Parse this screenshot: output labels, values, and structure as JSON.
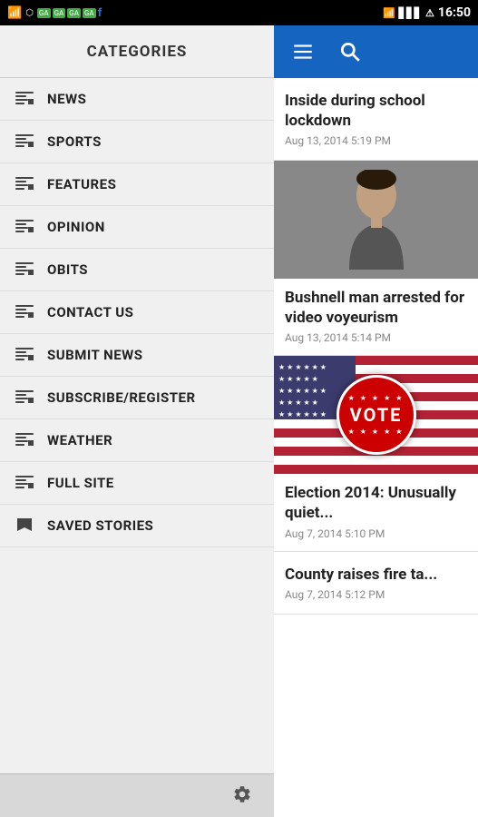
{
  "statusBar": {
    "time": "16:50",
    "icons_left": [
      "signal-icon",
      "wifi-icon",
      "battery-icon"
    ]
  },
  "sidebar": {
    "header": "CATEGORIES",
    "items": [
      {
        "id": "news",
        "label": "NEWS"
      },
      {
        "id": "sports",
        "label": "SPORTS"
      },
      {
        "id": "features",
        "label": "FEATURES"
      },
      {
        "id": "opinion",
        "label": "OPINION"
      },
      {
        "id": "obits",
        "label": "OBITS"
      },
      {
        "id": "contact",
        "label": "CONTACT US"
      },
      {
        "id": "submit",
        "label": "SUBMIT NEWS"
      },
      {
        "id": "subscribe",
        "label": "SUBSCRIBE/REGISTER"
      },
      {
        "id": "weather",
        "label": "WEATHER"
      },
      {
        "id": "fullsite",
        "label": "FULL SITE"
      },
      {
        "id": "saved",
        "label": "SAVED STORIES"
      }
    ],
    "footer_icon": "settings-icon"
  },
  "topBar": {
    "menu_icon": "menu-icon",
    "search_icon": "search-icon"
  },
  "newsList": {
    "items": [
      {
        "id": "item1",
        "title": "Inside during school lockdown",
        "date": "Aug 13, 2014 5:19 PM",
        "hasImage": false
      },
      {
        "id": "item2",
        "title": "Bushnell man arrested for video voyeurism",
        "date": "Aug 13, 2014 5:14 PM",
        "hasImage": true,
        "imageType": "person"
      },
      {
        "id": "item3",
        "title": "Election 2014: Unusually quiet...",
        "date": "Aug 7, 2014 5:10 PM",
        "hasImage": true,
        "imageType": "vote"
      },
      {
        "id": "item4",
        "title": "County raises fire ta...",
        "date": "Aug 7, 2014 5:12 PM",
        "hasImage": false
      }
    ]
  },
  "colors": {
    "accent": "#1565C0",
    "sidebar_bg": "#f0f0f0",
    "text_primary": "#222",
    "text_secondary": "#888"
  }
}
